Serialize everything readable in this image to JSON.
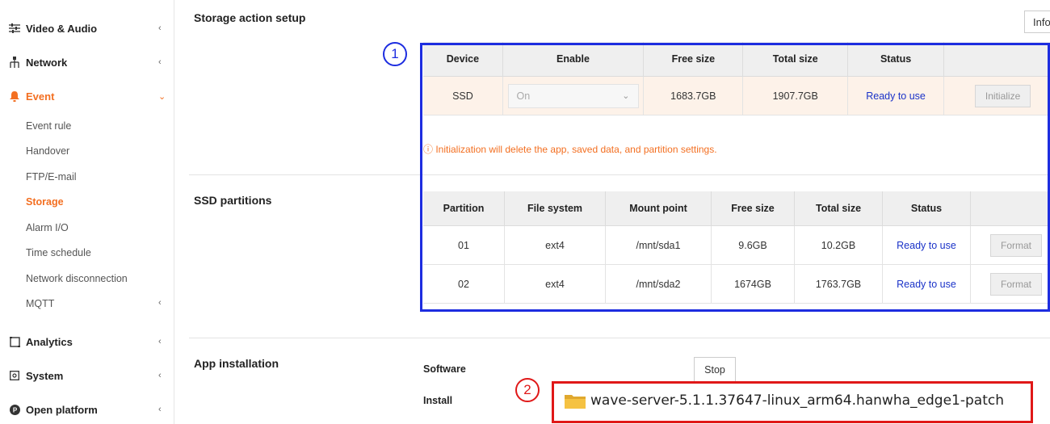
{
  "sidebar": {
    "video_audio": "Video & Audio",
    "network": "Network",
    "event": "Event",
    "event_children": [
      "Event rule",
      "Handover",
      "FTP/E-mail",
      "Storage",
      "Alarm I/O",
      "Time schedule",
      "Network disconnection",
      "MQTT"
    ],
    "analytics": "Analytics",
    "system": "System",
    "open_platform": "Open platform"
  },
  "main": {
    "storage_title": "Storage action setup",
    "info_button": "Info",
    "device_table": {
      "headers": [
        "Device",
        "Enable",
        "Free size",
        "Total size",
        "Status",
        ""
      ],
      "row": {
        "device": "SSD",
        "enable": "On",
        "free": "1683.7GB",
        "total": "1907.7GB",
        "status": "Ready to use",
        "action": "Initialize"
      }
    },
    "warning": "ⓘ Initialization will delete the app, saved data, and partition settings.",
    "partitions_title": "SSD partitions",
    "partition_table": {
      "headers": [
        "Partition",
        "File system",
        "Mount point",
        "Free size",
        "Total size",
        "Status",
        ""
      ],
      "rows": [
        {
          "partition": "01",
          "fs": "ext4",
          "mount": "/mnt/sda1",
          "free": "9.6GB",
          "total": "10.2GB",
          "status": "Ready to use",
          "action": "Format"
        },
        {
          "partition": "02",
          "fs": "ext4",
          "mount": "/mnt/sda2",
          "free": "1674GB",
          "total": "1763.7GB",
          "status": "Ready to use",
          "action": "Format"
        }
      ]
    },
    "app_title": "App installation",
    "software_label": "Software",
    "stop_button": "Stop",
    "install_label": "Install",
    "install_file": "wave-server-5.1.1.37647-linux_arm64.hanwha_edge1-patch"
  },
  "annotations": {
    "marker1": "1",
    "marker2": "2"
  },
  "colors": {
    "accent": "#f36f21",
    "status_link": "#1a32c8",
    "highlight_blue": "#1d2de0",
    "highlight_red": "#e01818"
  }
}
